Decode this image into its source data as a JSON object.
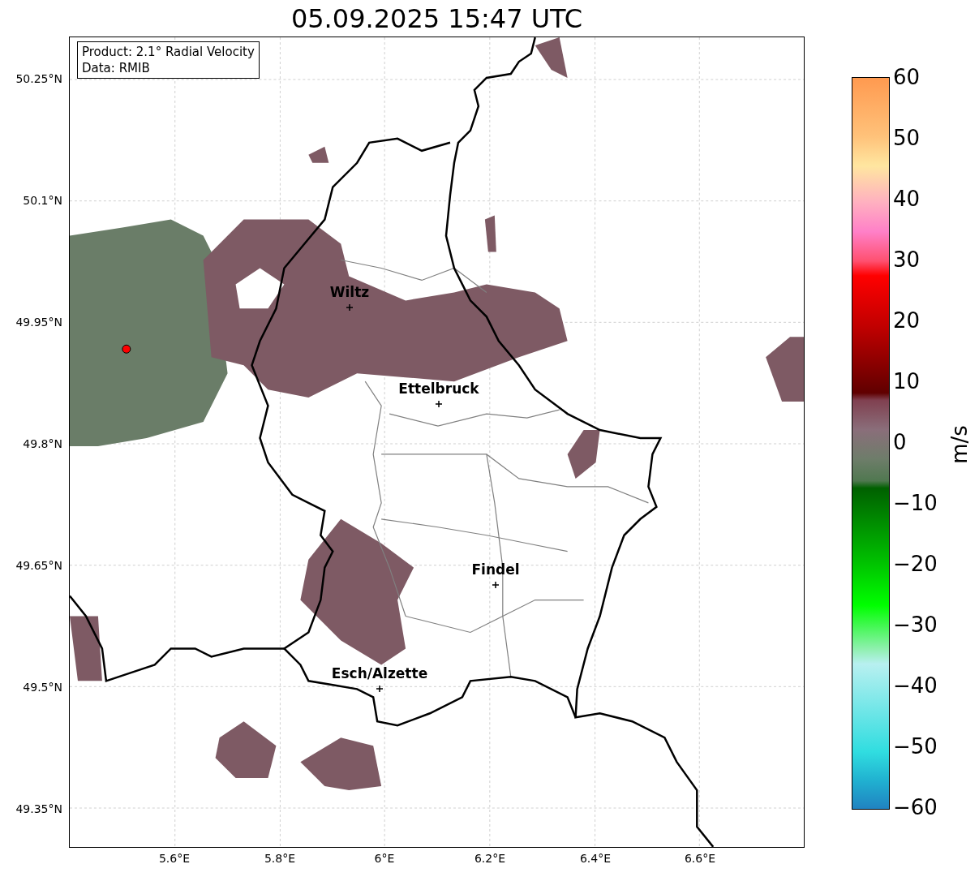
{
  "title": "05.09.2025 15:47 UTC",
  "info_box": {
    "lines": [
      "Product: 2.1° Radial Velocity",
      "Data: RMIB"
    ]
  },
  "map": {
    "lat_ticks": [
      "50.25°N",
      "50.1°N",
      "49.95°N",
      "49.8°N",
      "49.65°N",
      "49.5°N",
      "49.35°N"
    ],
    "lon_ticks": [
      "5.6°E",
      "5.8°E",
      "6°E",
      "6.2°E",
      "6.4°E",
      "6.6°E"
    ],
    "places": [
      {
        "name": "Wiltz"
      },
      {
        "name": "Ettelbruck"
      },
      {
        "name": "Findel"
      },
      {
        "name": "Esch/Alzette"
      }
    ]
  },
  "colorbar": {
    "label": "m/s",
    "ticks": [
      "60",
      "50",
      "40",
      "30",
      "20",
      "10",
      "0",
      "−10",
      "−20",
      "−30",
      "−40",
      "−50",
      "−60"
    ]
  }
}
